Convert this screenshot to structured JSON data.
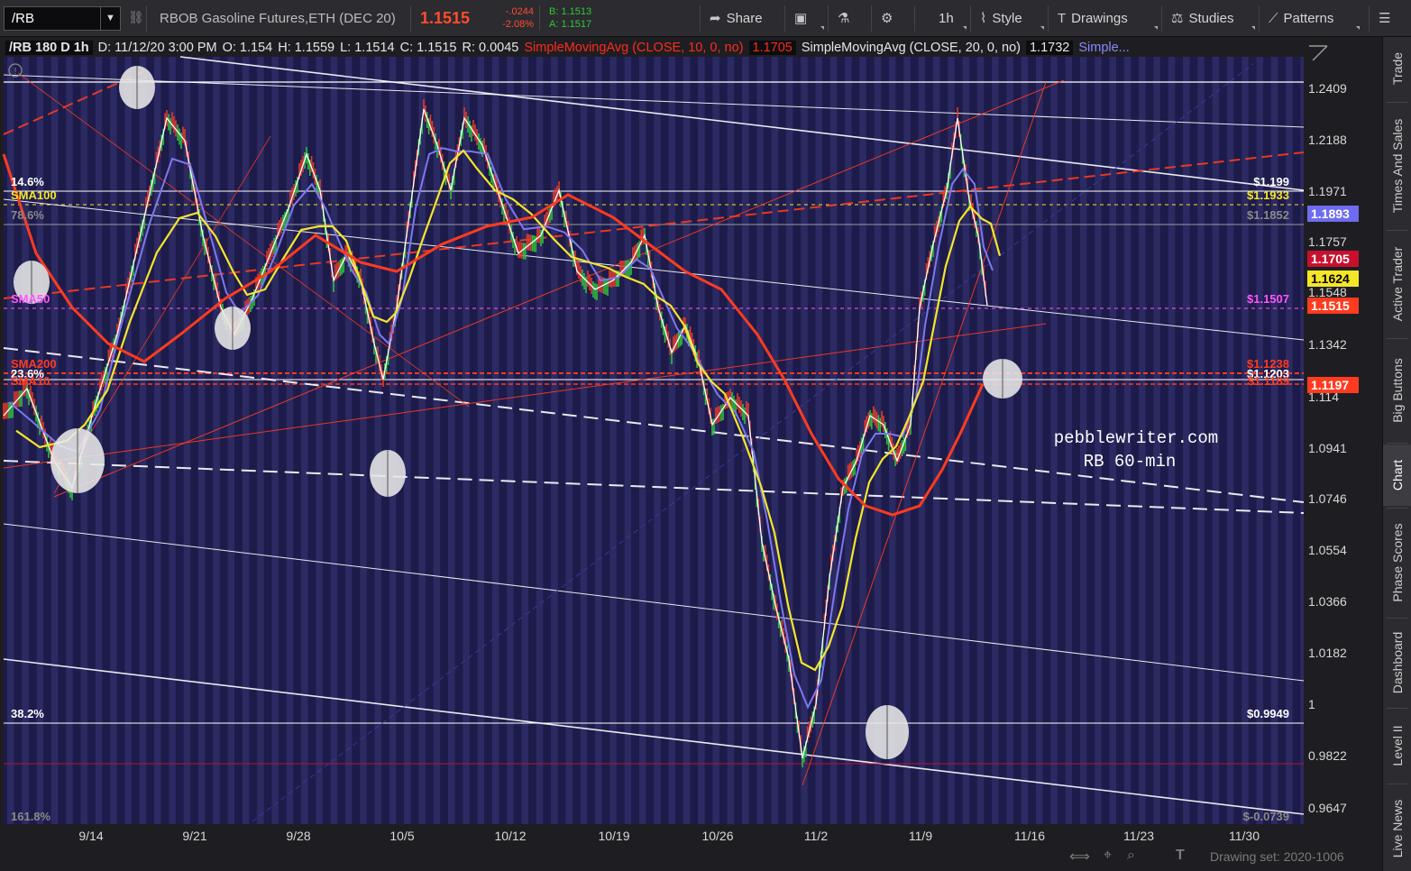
{
  "toolbar": {
    "symbol": "/RB",
    "instrument": "RBOB Gasoline Futures,ETH (DEC 20)",
    "last": "1.1515",
    "net_change": "-.0244",
    "pct_change": "-2.08%",
    "bid": "B: 1.1513",
    "ask": "A: 1.1517",
    "share": "Share",
    "interval": "1h",
    "style": "Style",
    "drawings": "Drawings",
    "studies": "Studies",
    "patterns": "Patterns"
  },
  "info_bar": {
    "symbol_period": "/RB 180 D 1h",
    "date": "D: 11/12/20 3:00 PM",
    "open": "O: 1.154",
    "high": "H: 1.1559",
    "low": "L: 1.1514",
    "close": "C: 1.1515",
    "range": "R: 0.0045",
    "sma10_label": "SimpleMovingAvg (CLOSE, 10, 0, no)",
    "sma10_value": "1.1705",
    "sma20_label": "SimpleMovingAvg (CLOSE, 20, 0, no)",
    "sma20_value": "1.1732",
    "more": "Simple..."
  },
  "sidebar": {
    "tabs": [
      "Trade",
      "Times And Sales",
      "Active Trader",
      "Big Buttons",
      "Chart",
      "Phase Scores",
      "Dashboard",
      "Level II",
      "Live News"
    ],
    "active": "Chart"
  },
  "chart": {
    "price_axis": [
      "1.2409",
      "1.2188",
      "1.1971",
      "1.1757",
      "1.1548",
      "1.1342",
      "1.114",
      "1.0941",
      "1.0746",
      "1.0554",
      "1.0366",
      "1.0182",
      "1",
      "0.9822",
      "0.9647"
    ],
    "date_axis": [
      "9/14",
      "9/21",
      "9/28",
      "10/5",
      "10/12",
      "10/19",
      "10/26",
      "11/2",
      "11/9",
      "11/16",
      "11/23",
      "11/30"
    ],
    "level_labels": {
      "fib146_left": "14.6%",
      "fib146_right": "$1.199",
      "sma100_left": "SMA100",
      "sma100_right": "$1.1933",
      "fib786_left": "78.6%",
      "fib786_right": "$1.1852",
      "sma50_left": "SMA50",
      "sma50_right": "$1.1507",
      "sma200_left": "SMA200",
      "sma200_right": "$1.1238",
      "fib236_left": "23.6%",
      "fib236_right": "$1.1203",
      "sma5_left": "SMA10",
      "sma5_right": "$1.1189",
      "fib382_left": "38.2%",
      "fib382_right": "$0.9949",
      "fib1618_left": "161.8%",
      "fib1618_right": "$-0.0739"
    },
    "price_tags": [
      {
        "value": "1.1893",
        "color": "#6e6cf0"
      },
      {
        "value": "1.1705",
        "color": "#c8102e"
      },
      {
        "value": "1.1624",
        "color": "#f5e62a"
      },
      {
        "value": "1.1515",
        "color": "#ff3b1f"
      },
      {
        "value": "1.1197",
        "color": "#ff3b1f"
      }
    ],
    "watermark_line1": "pebblewriter.com",
    "watermark_line2": "RB 60-min",
    "drawing_set": "Drawing set: 2020-1006"
  }
}
